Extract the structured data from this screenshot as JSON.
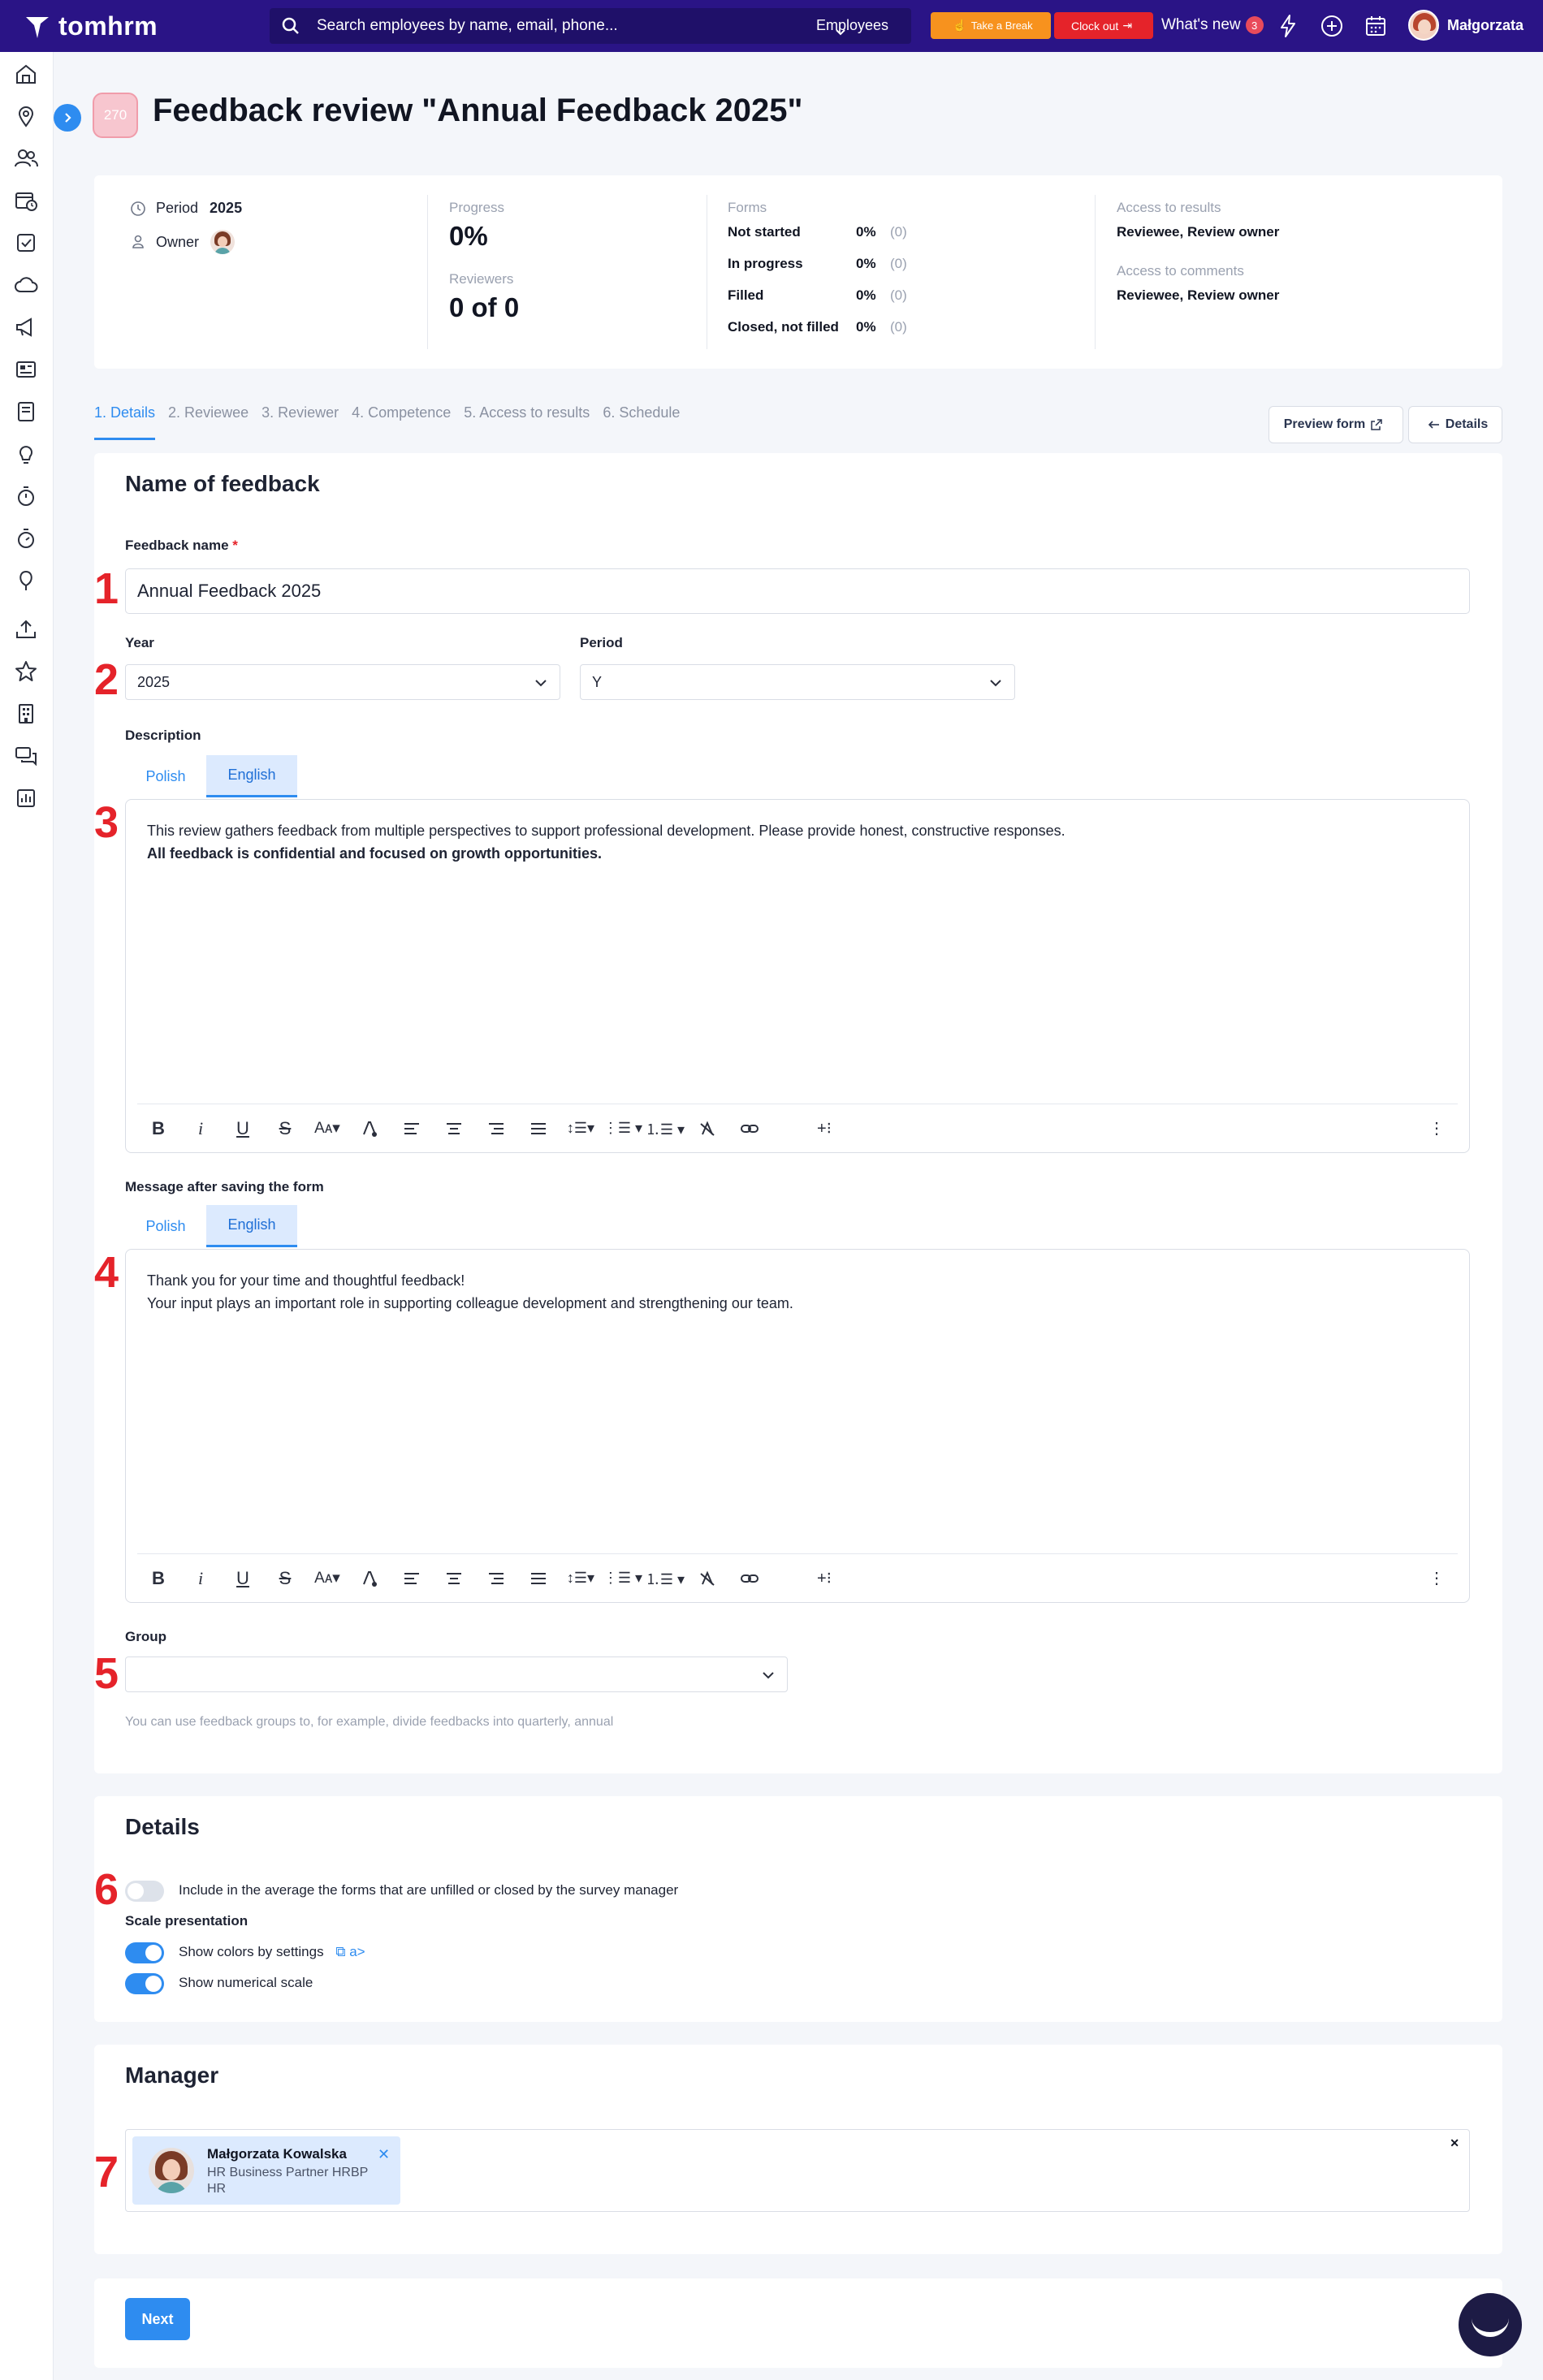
{
  "app": {
    "logo": "tomhrm",
    "search_placeholder": "Search employees by name, email, phone...",
    "search_scope": "Employees",
    "take_break": "Take a Break",
    "clock_out": "Clock out",
    "whats_new": "What's new",
    "whats_new_count": "3",
    "user_name": "Małgorzata",
    "colors": {
      "topbar": "#2a1486",
      "accent": "#2e8cf0",
      "break": "#f7921e",
      "clock_out": "#e5232a"
    }
  },
  "sidebar": {
    "icons": [
      "home-icon",
      "map-pin-icon",
      "people-icon",
      "calendar-clock-icon",
      "checkbox-icon",
      "cloud-icon",
      "megaphone-icon",
      "news-icon",
      "book-icon",
      "lightbulb-icon",
      "timer-icon",
      "stopwatch-icon",
      "balloon-icon",
      "upload-icon",
      "star-icon",
      "building-icon",
      "chat-icon",
      "report-icon"
    ]
  },
  "header": {
    "id_badge": "270",
    "title": "Feedback review \"Annual Feedback 2025\""
  },
  "summary": {
    "period_label": "Period",
    "period_value": "2025",
    "owner_label": "Owner",
    "progress_label": "Progress",
    "progress_value": "0%",
    "reviewers_label": "Reviewers",
    "reviewers_value": "0 of 0",
    "forms_label": "Forms",
    "forms": [
      {
        "label": "Not started",
        "pct": "0%",
        "count": "(0)"
      },
      {
        "label": "In progress",
        "pct": "0%",
        "count": "(0)"
      },
      {
        "label": "Filled",
        "pct": "0%",
        "count": "(0)"
      },
      {
        "label": "Closed, not filled",
        "pct": "0%",
        "count": "(0)"
      }
    ],
    "access_results_label": "Access to results",
    "access_results_value": "Reviewee, Review owner",
    "access_comments_label": "Access to comments",
    "access_comments_value": "Reviewee, Review owner"
  },
  "tabs": {
    "items": [
      "1. Details",
      "2. Reviewee",
      "3. Reviewer",
      "4. Competence",
      "5. Access to results",
      "6. Schedule"
    ],
    "active": 0,
    "preview_form": "Preview form",
    "details_back": "Details"
  },
  "form": {
    "section_title": "Name of feedback",
    "name_label": "Feedback name",
    "name_required": "*",
    "name_value": "Annual Feedback 2025",
    "year_label": "Year",
    "year_value": "2025",
    "period_label": "Period",
    "period_value": "Y",
    "description_label": "Description",
    "lang_tabs": [
      "Polish",
      "English"
    ],
    "active_lang": "English",
    "description_text_1": "This review gathers feedback from multiple perspectives to support professional development. Please provide honest, constructive responses.",
    "description_text_2": "All feedback is confidential and focused on growth opportunities.",
    "message_label": "Message after saving the form",
    "message_text_1": "Thank you for your time and thoughtful feedback!",
    "message_text_2": "Your input plays an important role in supporting colleague development and strengthening our team.",
    "group_label": "Group",
    "group_value": "",
    "group_hint": "You can use feedback groups to, for example, divide feedbacks into quarterly, annual"
  },
  "details": {
    "title": "Details",
    "include_unfilled_label": "Include in the average the forms that are unfilled or closed by the survey manager",
    "include_unfilled_on": false,
    "scale_title": "Scale presentation",
    "show_colors_label": "Show colors by settings",
    "show_colors_link": "a>",
    "show_colors_on": true,
    "show_numerical_label": "Show numerical scale",
    "show_numerical_on": true
  },
  "manager": {
    "title": "Manager",
    "name": "Małgorzata Kowalska",
    "role": "HR Business Partner HRBP",
    "department": "HR"
  },
  "footer": {
    "next": "Next"
  },
  "annotations": [
    "1",
    "2",
    "3",
    "4",
    "5",
    "6",
    "7"
  ]
}
